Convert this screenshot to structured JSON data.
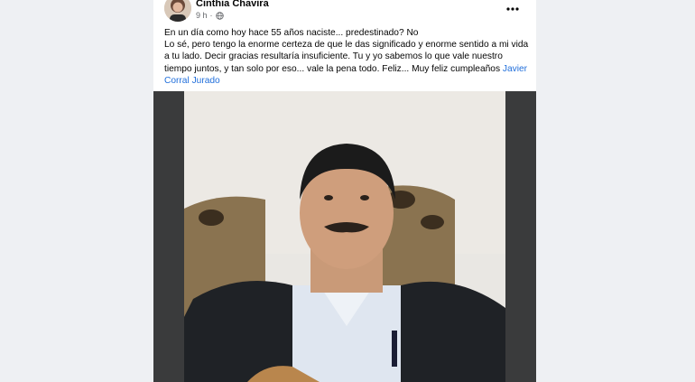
{
  "post": {
    "author": "Cinthia Chavira",
    "time": "9 h",
    "dot": "·",
    "lines": [
      "En un día como hoy hace 55 años naciste... predestinado? No",
      "Lo sé, pero tengo la enorme certeza de que le das significado y enorme sentido a mi vida a tu lado. Decir gracias resultaría insuficiente. Tu y yo sabemos lo que vale nuestro tiempo juntos, y tan solo por eso... vale la pena todo. Feliz... Muy feliz cumpleaños"
    ],
    "mention": "Javier Corral Jurado"
  },
  "icons": {
    "privacy": "globe-icon",
    "menu": "more-options-icon"
  },
  "colors": {
    "link": "#216fdb",
    "meta": "#65676b",
    "media_bg": "#3a3b3c"
  }
}
